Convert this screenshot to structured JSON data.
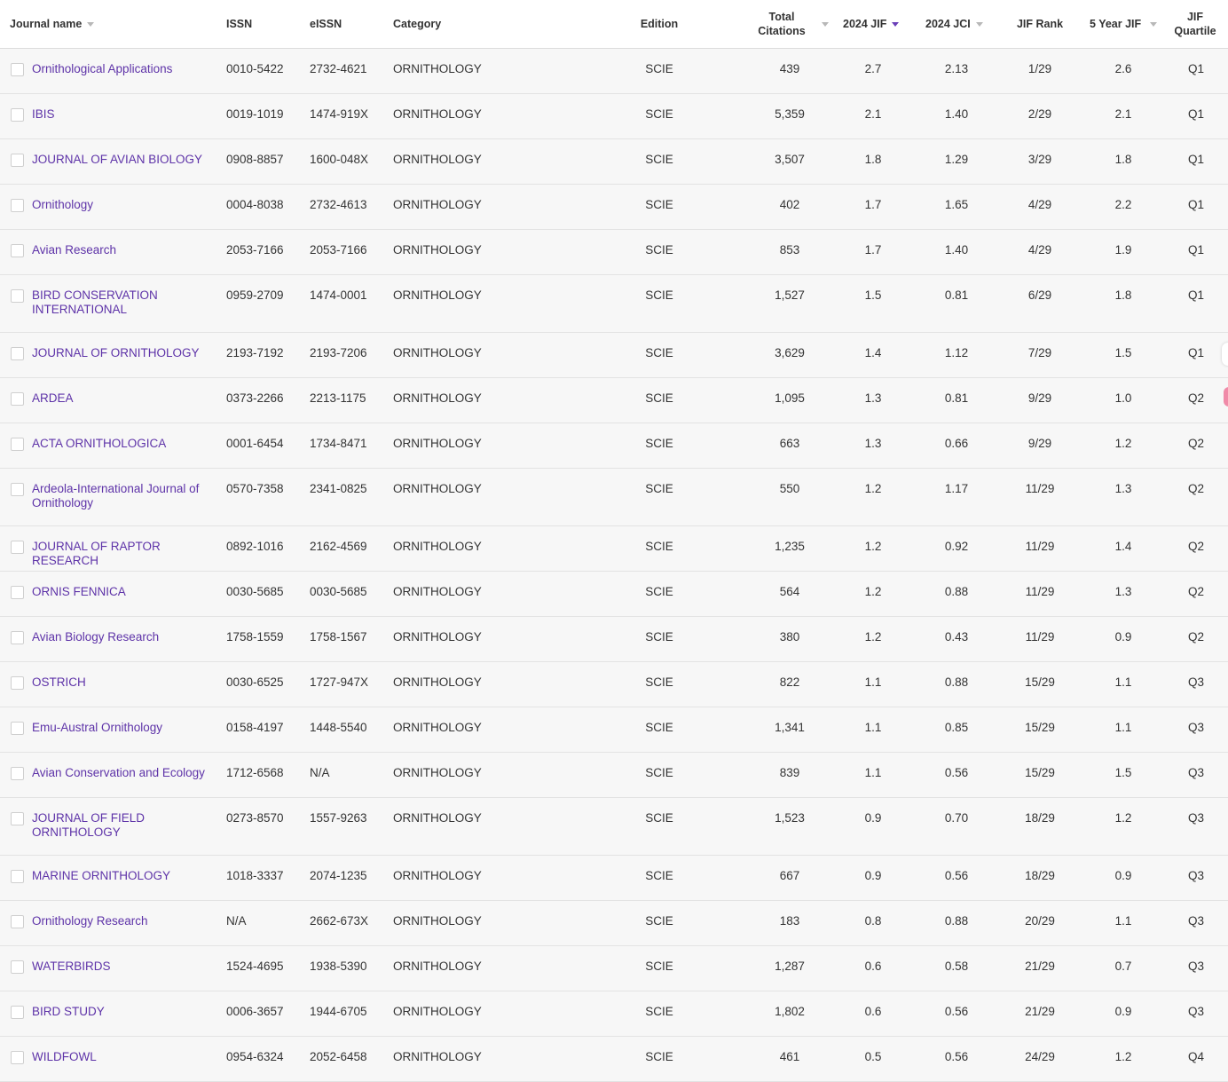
{
  "headers": {
    "journal_name": "Journal name",
    "issn": "ISSN",
    "eissn": "eISSN",
    "category": "Category",
    "edition": "Edition",
    "total_citations": "Total Citations",
    "jif_2024": "2024 JIF",
    "jci_2024": "2024 JCI",
    "jif_rank": "JIF Rank",
    "five_year_jif": "5 Year JIF",
    "jif_quartile": "JIF Quartile"
  },
  "colors": {
    "link": "#5e33a8",
    "active_sort": "#6a3fb8",
    "row_background": "#f7f7f7"
  },
  "rows": [
    {
      "name": "Ornithological Applications",
      "issn": "0010-5422",
      "eissn": "2732-4621",
      "category": "ORNITHOLOGY",
      "edition": "SCIE",
      "citations": "439",
      "jif": "2.7",
      "jci": "2.13",
      "rank": "1/29",
      "jif5": "2.6",
      "quartile": "Q1"
    },
    {
      "name": "IBIS",
      "issn": "0019-1019",
      "eissn": "1474-919X",
      "category": "ORNITHOLOGY",
      "edition": "SCIE",
      "citations": "5,359",
      "jif": "2.1",
      "jci": "1.40",
      "rank": "2/29",
      "jif5": "2.1",
      "quartile": "Q1"
    },
    {
      "name": "JOURNAL OF AVIAN BIOLOGY",
      "issn": "0908-8857",
      "eissn": "1600-048X",
      "category": "ORNITHOLOGY",
      "edition": "SCIE",
      "citations": "3,507",
      "jif": "1.8",
      "jci": "1.29",
      "rank": "3/29",
      "jif5": "1.8",
      "quartile": "Q1"
    },
    {
      "name": "Ornithology",
      "issn": "0004-8038",
      "eissn": "2732-4613",
      "category": "ORNITHOLOGY",
      "edition": "SCIE",
      "citations": "402",
      "jif": "1.7",
      "jci": "1.65",
      "rank": "4/29",
      "jif5": "2.2",
      "quartile": "Q1"
    },
    {
      "name": "Avian Research",
      "issn": "2053-7166",
      "eissn": "2053-7166",
      "category": "ORNITHOLOGY",
      "edition": "SCIE",
      "citations": "853",
      "jif": "1.7",
      "jci": "1.40",
      "rank": "4/29",
      "jif5": "1.9",
      "quartile": "Q1"
    },
    {
      "name": "BIRD CONSERVATION INTERNATIONAL",
      "issn": "0959-2709",
      "eissn": "1474-0001",
      "category": "ORNITHOLOGY",
      "edition": "SCIE",
      "citations": "1,527",
      "jif": "1.5",
      "jci": "0.81",
      "rank": "6/29",
      "jif5": "1.8",
      "quartile": "Q1"
    },
    {
      "name": "JOURNAL OF ORNITHOLOGY",
      "issn": "2193-7192",
      "eissn": "2193-7206",
      "category": "ORNITHOLOGY",
      "edition": "SCIE",
      "citations": "3,629",
      "jif": "1.4",
      "jci": "1.12",
      "rank": "7/29",
      "jif5": "1.5",
      "quartile": "Q1"
    },
    {
      "name": "ARDEA",
      "issn": "0373-2266",
      "eissn": "2213-1175",
      "category": "ORNITHOLOGY",
      "edition": "SCIE",
      "citations": "1,095",
      "jif": "1.3",
      "jci": "0.81",
      "rank": "9/29",
      "jif5": "1.0",
      "quartile": "Q2"
    },
    {
      "name": "ACTA ORNITHOLOGICA",
      "issn": "0001-6454",
      "eissn": "1734-8471",
      "category": "ORNITHOLOGY",
      "edition": "SCIE",
      "citations": "663",
      "jif": "1.3",
      "jci": "0.66",
      "rank": "9/29",
      "jif5": "1.2",
      "quartile": "Q2"
    },
    {
      "name": "Ardeola-International Journal of Ornithology",
      "issn": "0570-7358",
      "eissn": "2341-0825",
      "category": "ORNITHOLOGY",
      "edition": "SCIE",
      "citations": "550",
      "jif": "1.2",
      "jci": "1.17",
      "rank": "11/29",
      "jif5": "1.3",
      "quartile": "Q2"
    },
    {
      "name": "JOURNAL OF RAPTOR RESEARCH",
      "issn": "0892-1016",
      "eissn": "2162-4569",
      "category": "ORNITHOLOGY",
      "edition": "SCIE",
      "citations": "1,235",
      "jif": "1.2",
      "jci": "0.92",
      "rank": "11/29",
      "jif5": "1.4",
      "quartile": "Q2"
    },
    {
      "name": "ORNIS FENNICA",
      "issn": "0030-5685",
      "eissn": "0030-5685",
      "category": "ORNITHOLOGY",
      "edition": "SCIE",
      "citations": "564",
      "jif": "1.2",
      "jci": "0.88",
      "rank": "11/29",
      "jif5": "1.3",
      "quartile": "Q2"
    },
    {
      "name": "Avian Biology Research",
      "issn": "1758-1559",
      "eissn": "1758-1567",
      "category": "ORNITHOLOGY",
      "edition": "SCIE",
      "citations": "380",
      "jif": "1.2",
      "jci": "0.43",
      "rank": "11/29",
      "jif5": "0.9",
      "quartile": "Q2"
    },
    {
      "name": "OSTRICH",
      "issn": "0030-6525",
      "eissn": "1727-947X",
      "category": "ORNITHOLOGY",
      "edition": "SCIE",
      "citations": "822",
      "jif": "1.1",
      "jci": "0.88",
      "rank": "15/29",
      "jif5": "1.1",
      "quartile": "Q3"
    },
    {
      "name": "Emu-Austral Ornithology",
      "issn": "0158-4197",
      "eissn": "1448-5540",
      "category": "ORNITHOLOGY",
      "edition": "SCIE",
      "citations": "1,341",
      "jif": "1.1",
      "jci": "0.85",
      "rank": "15/29",
      "jif5": "1.1",
      "quartile": "Q3"
    },
    {
      "name": "Avian Conservation and Ecology",
      "issn": "1712-6568",
      "eissn": "N/A",
      "category": "ORNITHOLOGY",
      "edition": "SCIE",
      "citations": "839",
      "jif": "1.1",
      "jci": "0.56",
      "rank": "15/29",
      "jif5": "1.5",
      "quartile": "Q3"
    },
    {
      "name": "JOURNAL OF FIELD ORNITHOLOGY",
      "issn": "0273-8570",
      "eissn": "1557-9263",
      "category": "ORNITHOLOGY",
      "edition": "SCIE",
      "citations": "1,523",
      "jif": "0.9",
      "jci": "0.70",
      "rank": "18/29",
      "jif5": "1.2",
      "quartile": "Q3"
    },
    {
      "name": "MARINE ORNITHOLOGY",
      "issn": "1018-3337",
      "eissn": "2074-1235",
      "category": "ORNITHOLOGY",
      "edition": "SCIE",
      "citations": "667",
      "jif": "0.9",
      "jci": "0.56",
      "rank": "18/29",
      "jif5": "0.9",
      "quartile": "Q3"
    },
    {
      "name": "Ornithology Research",
      "issn": "N/A",
      "eissn": "2662-673X",
      "category": "ORNITHOLOGY",
      "edition": "SCIE",
      "citations": "183",
      "jif": "0.8",
      "jci": "0.88",
      "rank": "20/29",
      "jif5": "1.1",
      "quartile": "Q3"
    },
    {
      "name": "WATERBIRDS",
      "issn": "1524-4695",
      "eissn": "1938-5390",
      "category": "ORNITHOLOGY",
      "edition": "SCIE",
      "citations": "1,287",
      "jif": "0.6",
      "jci": "0.58",
      "rank": "21/29",
      "jif5": "0.7",
      "quartile": "Q3"
    },
    {
      "name": "BIRD STUDY",
      "issn": "0006-3657",
      "eissn": "1944-6705",
      "category": "ORNITHOLOGY",
      "edition": "SCIE",
      "citations": "1,802",
      "jif": "0.6",
      "jci": "0.56",
      "rank": "21/29",
      "jif5": "0.9",
      "quartile": "Q3"
    },
    {
      "name": "WILDFOWL",
      "issn": "0954-6324",
      "eissn": "2052-6458",
      "category": "ORNITHOLOGY",
      "edition": "SCIE",
      "citations": "461",
      "jif": "0.5",
      "jci": "0.56",
      "rank": "24/29",
      "jif5": "1.2",
      "quartile": "Q4"
    }
  ]
}
